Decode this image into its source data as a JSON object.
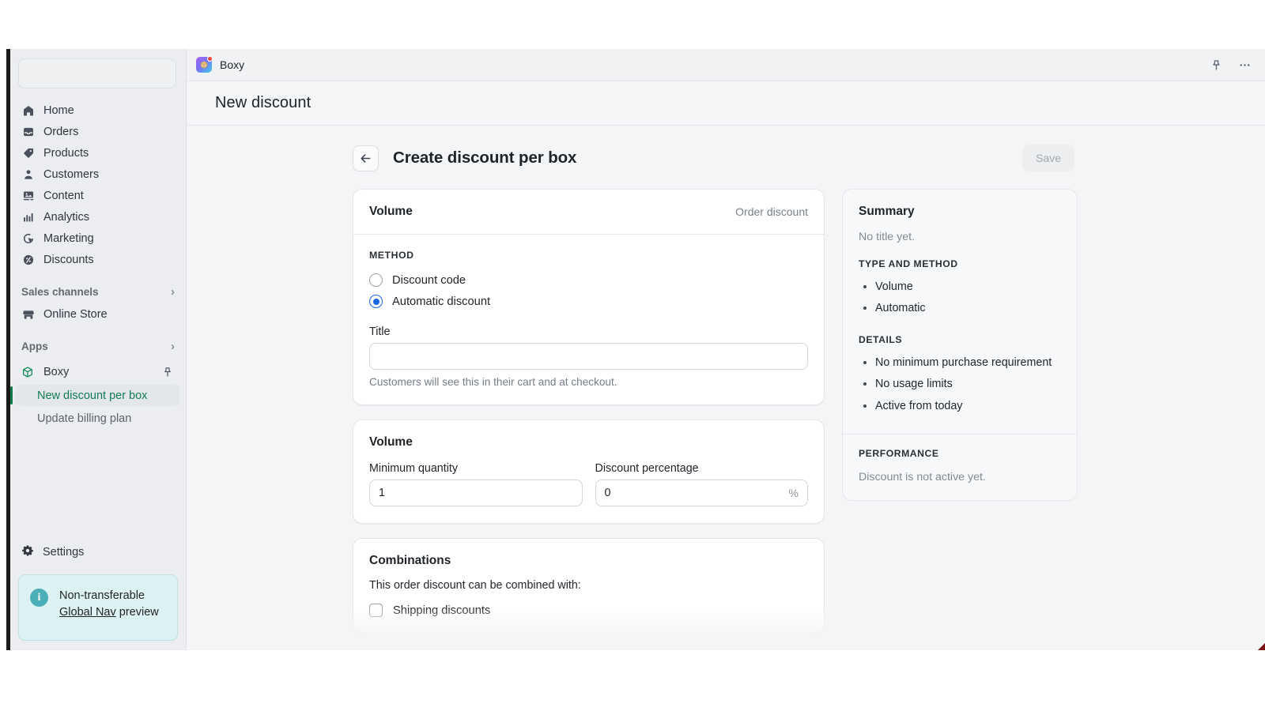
{
  "window": {
    "app_name": "Boxy",
    "page_title": "New discount",
    "pin_icon": "pin-icon",
    "more_icon": "ellipsis-icon"
  },
  "sidebar": {
    "search_placeholder": "",
    "nav_items": [
      {
        "label": "Home",
        "icon": "home-icon"
      },
      {
        "label": "Orders",
        "icon": "orders-inbox-icon"
      },
      {
        "label": "Products",
        "icon": "tag-icon"
      },
      {
        "label": "Customers",
        "icon": "person-icon"
      },
      {
        "label": "Content",
        "icon": "image-icon"
      },
      {
        "label": "Analytics",
        "icon": "bar-chart-icon"
      },
      {
        "label": "Marketing",
        "icon": "marketing-target-icon"
      },
      {
        "label": "Discounts",
        "icon": "discount-percent-icon"
      }
    ],
    "sections": [
      {
        "label": "Sales channels",
        "chevron": "›"
      },
      {
        "label": "Apps",
        "chevron": "›"
      }
    ],
    "online_store": {
      "label": "Online Store",
      "icon": "store-icon"
    },
    "app": {
      "label": "Boxy",
      "icon": "box-outline-icon",
      "pin_icon": "pin-icon",
      "sub_items": [
        {
          "label": "New discount per box",
          "active": true
        },
        {
          "label": "Update billing plan",
          "active": false
        }
      ]
    },
    "settings": {
      "label": "Settings",
      "icon": "gear-icon"
    },
    "banner": {
      "icon": "info-icon",
      "line1": "Non-transferable",
      "link_text": "Global Nav",
      "line2_suffix": " preview"
    }
  },
  "page": {
    "back_icon": "arrow-left-icon",
    "heading": "Create discount per box",
    "save_label": "Save"
  },
  "volume_card": {
    "title": "Volume",
    "subtitle": "Order discount",
    "method_label": "Method",
    "method_options": [
      {
        "label": "Discount code",
        "selected": false
      },
      {
        "label": "Automatic discount",
        "selected": true
      }
    ],
    "title_field_label": "Title",
    "title_field_value": "",
    "title_field_placeholder": "",
    "title_helper": "Customers will see this in their cart and at checkout."
  },
  "volume_values_card": {
    "title": "Volume",
    "min_quantity_label": "Minimum quantity",
    "min_quantity_value": "1",
    "discount_pct_label": "Discount percentage",
    "discount_pct_value": "0",
    "discount_pct_suffix": "%"
  },
  "combinations_card": {
    "title": "Combinations",
    "note": "This order discount can be combined with:",
    "options": [
      {
        "label": "Shipping discounts",
        "checked": false
      }
    ]
  },
  "summary": {
    "title": "Summary",
    "no_title_text": "No title yet.",
    "type_method_heading": "Type and method",
    "type_method_items": [
      "Volume",
      "Automatic"
    ],
    "details_heading": "Details",
    "details_items": [
      "No minimum purchase requirement",
      "No usage limits",
      "Active from today"
    ],
    "performance_heading": "Performance",
    "performance_text": "Discount is not active yet."
  },
  "colors": {
    "accent_green": "#0f7b4f",
    "accent_blue": "#1a66e0",
    "banner_bg": "#ddf2f3",
    "banner_icon": "#4aafb8",
    "sidebar_bg": "#ebedf0",
    "content_bg": "#f4f5f6"
  }
}
